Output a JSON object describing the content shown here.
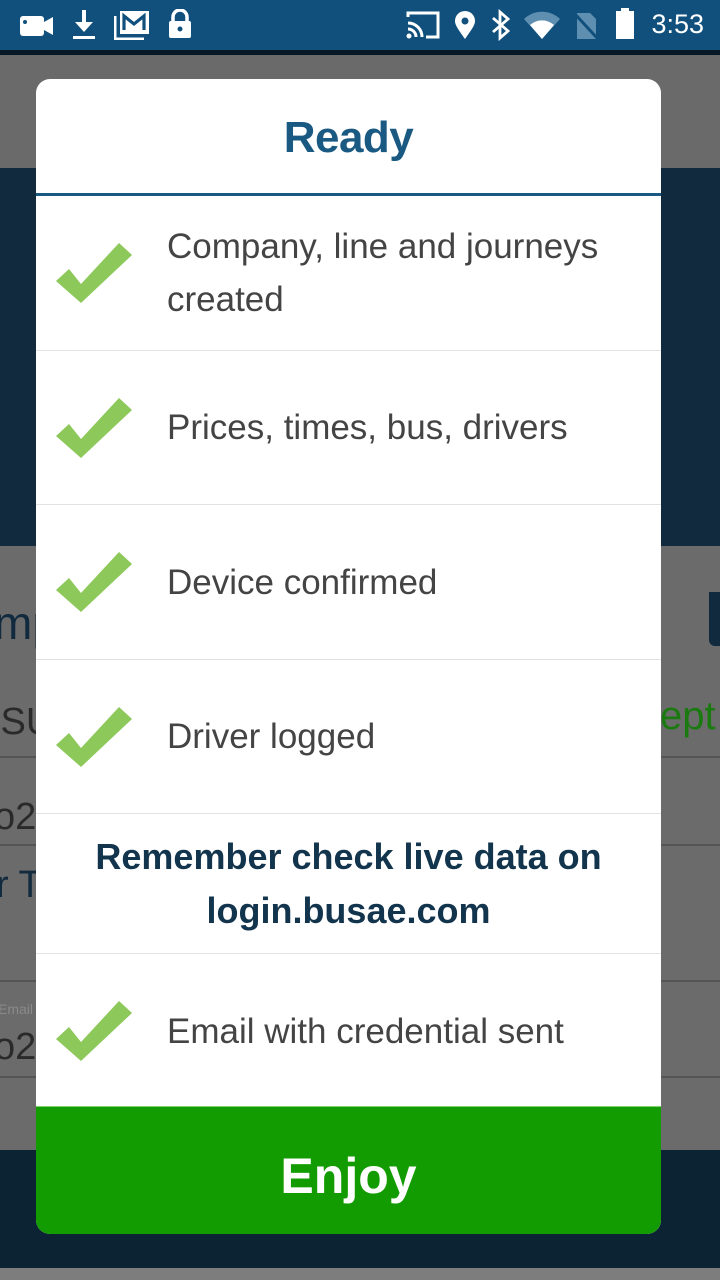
{
  "status_bar": {
    "left_icons": [
      "video-camera-icon",
      "download-icon",
      "gmail-icon",
      "lock-icon"
    ],
    "right_icons": [
      "cast-icon",
      "location-pin-icon",
      "bluetooth-icon",
      "wifi-icon",
      "no-sim-icon",
      "battery-icon"
    ],
    "time": "3:53"
  },
  "background_app": {
    "fragments": {
      "heading_partial": "mp",
      "column_partial": "ISU",
      "accept_partial": "ept",
      "value_partial_1": "o2",
      "link_partial": "r Te",
      "email_label_partial": "Email (",
      "value_partial_2": "o2"
    },
    "colors": {
      "header": "#112a3e",
      "accept": "#1a7a10"
    }
  },
  "dialog": {
    "title": "Ready",
    "items": [
      {
        "label_line1": "Company, line and journeys",
        "label_line2": "created",
        "status": "done"
      },
      {
        "label_line1": "Prices, times, bus, drivers",
        "status": "done"
      },
      {
        "label_line1": "Device confirmed",
        "status": "done"
      },
      {
        "label_line1": "Driver logged",
        "status": "done"
      }
    ],
    "note_line1": "Remember check live data on",
    "note_line2": "login.busae.com",
    "final_item": {
      "label_line1": "Email with credential sent",
      "status": "done"
    },
    "button_label": "Enjoy",
    "colors": {
      "title": "#1a5a82",
      "check": "#8cc85a",
      "note": "#12344c",
      "button": "#139c02"
    }
  }
}
